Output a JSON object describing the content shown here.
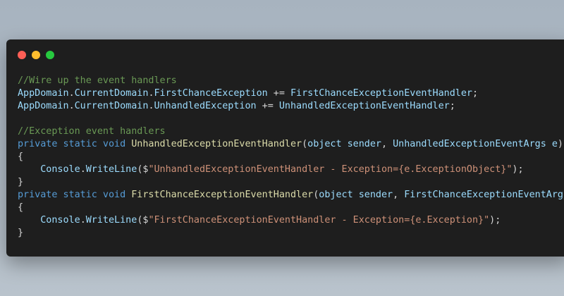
{
  "colors": {
    "close": "#ff5f56",
    "minimize": "#ffbd2e",
    "maximize": "#27c93f",
    "editor_bg": "#1e1e1e",
    "comment": "#6a9955",
    "identifier": "#9cdcfe",
    "method": "#dcdcaa",
    "keyword": "#569cd6",
    "string": "#ce9178",
    "default": "#d4d4d4"
  },
  "code_lines": [
    [
      {
        "t": "comment",
        "v": "//Wire up the event handlers"
      }
    ],
    [
      {
        "t": "ident",
        "v": "AppDomain"
      },
      {
        "t": "punct",
        "v": "."
      },
      {
        "t": "ident",
        "v": "CurrentDomain"
      },
      {
        "t": "punct",
        "v": "."
      },
      {
        "t": "ident",
        "v": "FirstChanceException"
      },
      {
        "t": "punct",
        "v": " += "
      },
      {
        "t": "ident",
        "v": "FirstChanceExceptionEventHandler"
      },
      {
        "t": "punct",
        "v": ";"
      }
    ],
    [
      {
        "t": "ident",
        "v": "AppDomain"
      },
      {
        "t": "punct",
        "v": "."
      },
      {
        "t": "ident",
        "v": "CurrentDomain"
      },
      {
        "t": "punct",
        "v": "."
      },
      {
        "t": "ident",
        "v": "UnhandledException"
      },
      {
        "t": "punct",
        "v": " += "
      },
      {
        "t": "ident",
        "v": "UnhandledExceptionEventHandler"
      },
      {
        "t": "punct",
        "v": ";"
      }
    ],
    [],
    [
      {
        "t": "comment",
        "v": "//Exception event handlers"
      }
    ],
    [
      {
        "t": "keyword",
        "v": "private static void "
      },
      {
        "t": "method",
        "v": "UnhandledExceptionEventHandler"
      },
      {
        "t": "punct",
        "v": "("
      },
      {
        "t": "ident",
        "v": "object sender"
      },
      {
        "t": "punct",
        "v": ", "
      },
      {
        "t": "ident",
        "v": "UnhandledExceptionEventArgs e"
      },
      {
        "t": "punct",
        "v": ")"
      }
    ],
    [
      {
        "t": "punct",
        "v": "{"
      }
    ],
    [
      {
        "t": "punct",
        "v": "    "
      },
      {
        "t": "ident",
        "v": "Console"
      },
      {
        "t": "punct",
        "v": "."
      },
      {
        "t": "ident",
        "v": "WriteLine"
      },
      {
        "t": "punct",
        "v": "($"
      },
      {
        "t": "string",
        "v": "\"UnhandledExceptionEventHandler - Exception={e.ExceptionObject}\""
      },
      {
        "t": "punct",
        "v": ");"
      }
    ],
    [
      {
        "t": "punct",
        "v": "}"
      }
    ],
    [
      {
        "t": "keyword",
        "v": "private static void "
      },
      {
        "t": "method",
        "v": "FirstChanceExceptionEventHandler"
      },
      {
        "t": "punct",
        "v": "("
      },
      {
        "t": "ident",
        "v": "object sender"
      },
      {
        "t": "punct",
        "v": ", "
      },
      {
        "t": "ident",
        "v": "FirstChanceExceptionEventArgs e"
      },
      {
        "t": "punct",
        "v": ")"
      }
    ],
    [
      {
        "t": "punct",
        "v": "{"
      }
    ],
    [
      {
        "t": "punct",
        "v": "    "
      },
      {
        "t": "ident",
        "v": "Console"
      },
      {
        "t": "punct",
        "v": "."
      },
      {
        "t": "ident",
        "v": "WriteLine"
      },
      {
        "t": "punct",
        "v": "($"
      },
      {
        "t": "string",
        "v": "\"FirstChanceExceptionEventHandler - Exception={e.Exception}\""
      },
      {
        "t": "punct",
        "v": ");"
      }
    ],
    [
      {
        "t": "punct",
        "v": "}"
      }
    ]
  ]
}
